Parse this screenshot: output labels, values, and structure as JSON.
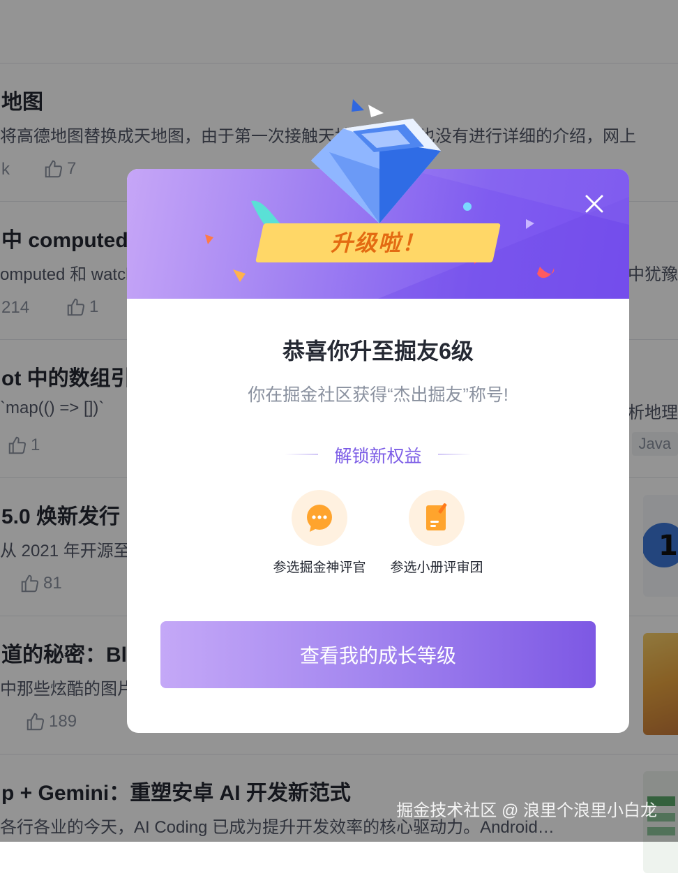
{
  "feed": {
    "items": [
      {
        "title": "地图",
        "desc": "将高德地图替换成天地图，由于第一次接触天地图，网站也没有进行详细的介绍，网上",
        "left_meta": "k",
        "likes": "7",
        "right_desc": "",
        "tag": ""
      },
      {
        "title": "中 computed",
        "desc": "omputed 和 watch",
        "left_meta": "214",
        "likes": "1",
        "right_desc": "中犹豫",
        "tag": ""
      },
      {
        "title": "ot 中的数组引",
        "desc": "`map(() => [])`",
        "left_meta": "",
        "likes": "1",
        "right_desc": "析地理",
        "tag": "Java"
      },
      {
        "title": "5.0 焕新发行",
        "desc": "从 2021 年开源至",
        "left_meta": "",
        "likes": "81",
        "right_desc": "",
        "tag": ""
      },
      {
        "title": "道的秘密：Blob",
        "desc": "中那些炫酷的图片",
        "left_meta": "",
        "likes": "189",
        "right_desc": "",
        "tag": ""
      },
      {
        "title": "p + Gemini：重塑安卓 AI 开发新范式",
        "desc": "各行各业的今天，AI Coding 已成为提升开发效率的核心驱动力。Android…",
        "left_meta": "",
        "likes": "",
        "right_desc": "",
        "tag": ""
      }
    ],
    "watermark": "掘金技术社区 @ 浪里个浪里小白龙"
  },
  "modal": {
    "banner": "升级啦！",
    "title": "恭喜你升至掘友6级",
    "subtitle": "你在掘金社区获得“杰出掘友”称号!",
    "section_title": "解锁新权益",
    "benefits": [
      {
        "label": "参选掘金神评官",
        "icon": "comment-icon"
      },
      {
        "label": "参选小册评审团",
        "icon": "booklet-review-icon"
      }
    ],
    "cta": "查看我的成长等级",
    "colors": {
      "accent": "#7b5ce6",
      "banner_bg": "#ffd767",
      "banner_text": "#e36b12",
      "benefit_icon": "#ffa42d"
    }
  }
}
